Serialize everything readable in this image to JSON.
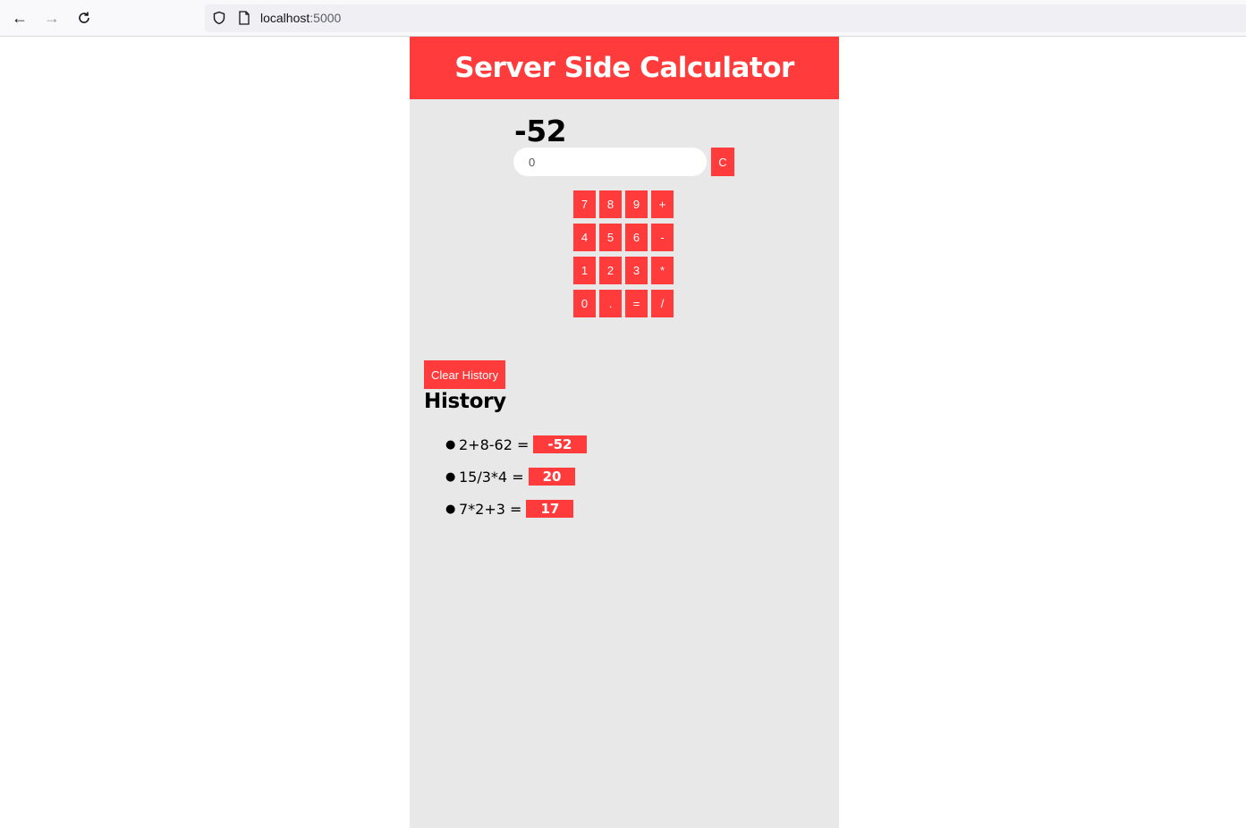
{
  "browser": {
    "url_host": "localhost",
    "url_port": ":5000"
  },
  "app": {
    "title": "Server Side Calculator",
    "result": "-52",
    "input_value": "0",
    "clear_label": "C",
    "keys": [
      "7",
      "8",
      "9",
      "+",
      "4",
      "5",
      "6",
      "-",
      "1",
      "2",
      "3",
      "*",
      "0",
      ".",
      "=",
      "/"
    ],
    "accent_color": "#ff3b3b"
  },
  "history": {
    "clear_label": "Clear History",
    "title": "History",
    "items": [
      {
        "expression": "2+8-62 =",
        "answer": "-52"
      },
      {
        "expression": "15/3*4 =",
        "answer": "20"
      },
      {
        "expression": "7*2+3 =",
        "answer": "17"
      }
    ]
  }
}
